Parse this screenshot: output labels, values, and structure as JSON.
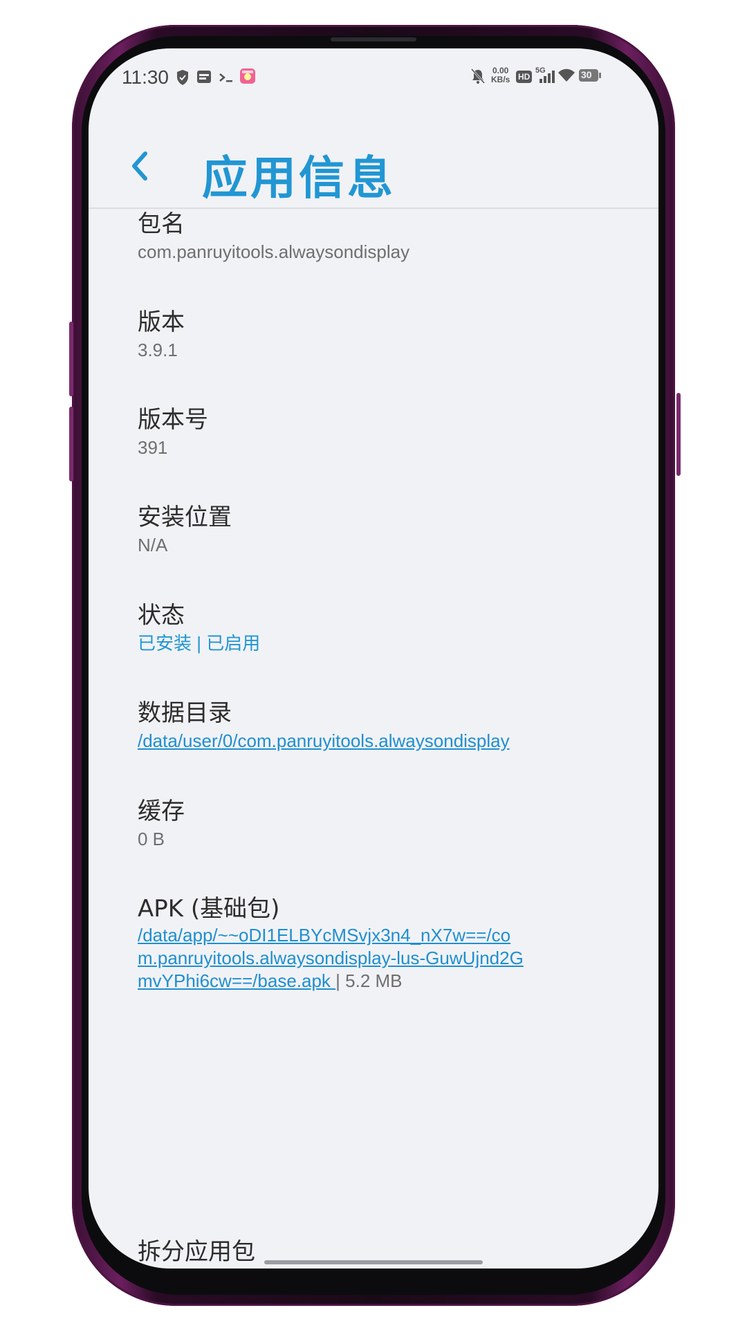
{
  "status_bar": {
    "time": "11:30",
    "net_speed_value": "0.00",
    "net_speed_unit": "KB/s",
    "signal_label": "5G",
    "hd_label": "HD",
    "battery": "30",
    "icons": [
      "shield-icon",
      "sim-card-icon",
      "terminal-icon",
      "app-notification-icon",
      "mute-bell-icon",
      "hd-icon",
      "signal-icon",
      "wifi-icon",
      "battery-icon"
    ]
  },
  "header": {
    "title": "应用信息",
    "back_icon": "chevron-left-icon",
    "accent_color": "#2196d3"
  },
  "info": {
    "package": {
      "label": "包名",
      "value": "com.panruyitools.alwaysondisplay"
    },
    "version": {
      "label": "版本",
      "value": "3.9.1"
    },
    "version_code": {
      "label": "版本号",
      "value": "391"
    },
    "install_location": {
      "label": "安装位置",
      "value": "N/A"
    },
    "status": {
      "label": "状态",
      "value": "已安装 | 已启用"
    },
    "data_dir": {
      "label": "数据目录",
      "value": "/data/user/0/com.panruyitools.alwaysondisplay"
    },
    "cache": {
      "label": "缓存",
      "value": "0 B"
    },
    "apk": {
      "label": "APK (基础包)",
      "path": "/data/app/~~oDI1ELBYcMSvjx3n4_nX7w==/com.panruyitools.alwaysondisplay-lus-GuwUjnd2GmvYPhi6cw==/base.apk ",
      "size": "| 5.2 MB"
    },
    "next_partial": "拆分应用包"
  }
}
